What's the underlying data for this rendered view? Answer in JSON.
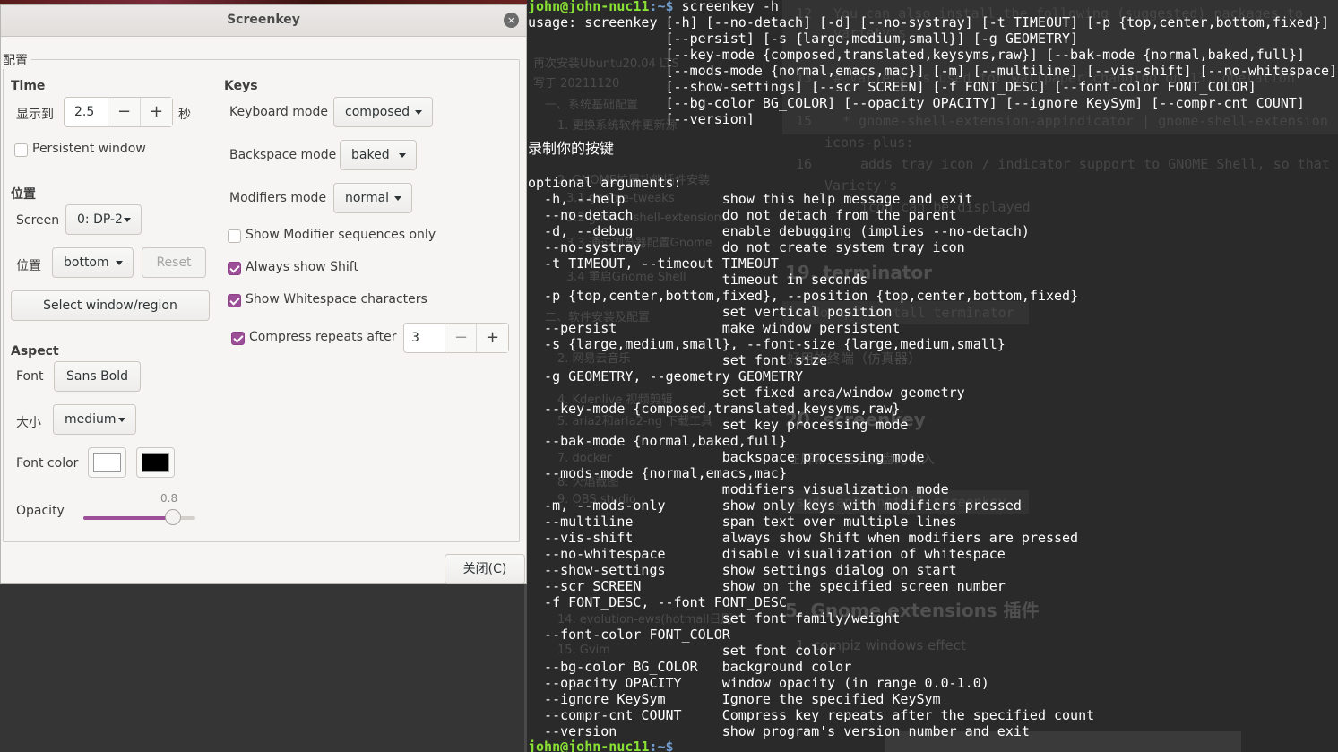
{
  "dialog": {
    "title": "Screenkey",
    "close_glyph": "×",
    "section_config": "配置",
    "time": {
      "header": "Time",
      "show_label": "显示到",
      "show_value": "2.5",
      "unit": "秒",
      "minus": "−",
      "plus": "+",
      "persistent_label": "Persistent window",
      "persistent_checked": false
    },
    "position": {
      "header": "位置",
      "screen_label": "Screen",
      "screen_value": "0: DP-2",
      "pos_label": "位置",
      "pos_value": "bottom",
      "reset_label": "Reset",
      "select_label": "Select window/region"
    },
    "aspect": {
      "header": "Aspect",
      "font_label": "Font",
      "font_value": "Sans Bold",
      "size_label": "大小",
      "size_value": "medium",
      "color_label": "Font color",
      "font_color": "#ffffff",
      "bg_color": "#000000",
      "opacity_label": "Opacity",
      "opacity_value": "0.8",
      "opacity_fraction": 0.8
    },
    "keys": {
      "header": "Keys",
      "keyboard_label": "Keyboard mode",
      "keyboard_value": "composed",
      "backspace_label": "Backspace mode",
      "backspace_value": "baked",
      "modifiers_label": "Modifiers mode",
      "modifiers_value": "normal",
      "mod_seq_label": "Show Modifier sequences only",
      "mod_seq_checked": false,
      "shift_label": "Always show Shift",
      "shift_checked": true,
      "whitespace_label": "Show Whitespace characters",
      "whitespace_checked": true,
      "compress_label": "Compress repeats after",
      "compress_checked": true,
      "compress_value": "3"
    },
    "close_button": "关闭(C)",
    "accent_color": "#9c4f96"
  },
  "terminal": {
    "prompt_user": "john@john-nuc11",
    "prompt_sep": ":~$",
    "command": " screenkey -h",
    "lines": [
      "usage: screenkey [-h] [--no-detach] [-d] [--no-systray] [-t TIMEOUT] [-p {top,center,bottom,fixed}]",
      "                 [--persist] [-s {large,medium,small}] [-g GEOMETRY]",
      "                 [--key-mode {composed,translated,keysyms,raw}] [--bak-mode {normal,baked,full}]",
      "                 [--mods-mode {normal,emacs,mac}] [-m] [--multiline] [--vis-shift] [--no-whitespace]",
      "                 [--show-settings] [--scr SCREEN] [-f FONT_DESC] [--font-color FONT_COLOR]",
      "                 [--bg-color BG_COLOR] [--opacity OPACITY] [--ignore KeySym] [--compr-cnt COUNT]",
      "                 [--version]"
    ],
    "heading_cn": "录制你的按键",
    "optional_header": "optional arguments:",
    "options": [
      "  -h, --help            show this help message and exit",
      "  --no-detach           do not detach from the parent",
      "  -d, --debug           enable debugging (implies --no-detach)",
      "  --no-systray          do not create system tray icon",
      "  -t TIMEOUT, --timeout TIMEOUT",
      "                        timeout in seconds",
      "  -p {top,center,bottom,fixed}, --position {top,center,bottom,fixed}",
      "                        set vertical position",
      "  --persist             make window persistent",
      "  -s {large,medium,small}, --font-size {large,medium,small}",
      "                        set font size",
      "  -g GEOMETRY, --geometry GEOMETRY",
      "                        set fixed area/window geometry",
      "  --key-mode {composed,translated,keysyms,raw}",
      "                        set key processing mode",
      "  --bak-mode {normal,baked,full}",
      "                        backspace processing mode",
      "  --mods-mode {normal,emacs,mac}",
      "                        modifiers visualization mode",
      "  -m, --mods-only       show only keys with modifiers pressed",
      "  --multiline           span text over multiple lines",
      "  --vis-shift           always show Shift when modifiers are pressed",
      "  --no-whitespace       disable visualization of whitespace",
      "  --show-settings       show settings dialog on start",
      "  --scr SCREEN          show on the specified screen number",
      "  -f FONT_DESC, --font FONT_DESC",
      "                        set font family/weight",
      "  --font-color FONT_COLOR",
      "                        set font color",
      "  --bg-color BG_COLOR   background color",
      "  --opacity OPACITY     window opacity (in range 0.0-1.0)",
      "  --ignore KeySym       Ignore the specified KeySym",
      "  --compr-cnt COUNT     Compress key repeats after the specified count",
      "  --version             show program's version number and exit"
    ],
    "final_prompt_user": "john@john-nuc11",
    "final_prompt_sep": ":~$"
  },
  "background_doc": {
    "toc": [
      "再次安装Ubuntu20.04 LTS",
      "写于 20211120",
      "一、系统基础配置",
      "1. 更换系统软件更新源",
      "2. GNOME扩展功能插件安装",
      "3.1 gnome-tweaks",
      "3.2 gnome-shell-extensions",
      "3.3 通过浏览器配置Gnome",
      "3.4 重启Gnome Shell",
      "二、软件安装及配置",
      "2. 网易云音乐",
      "4. Kdenlive 视频剪辑",
      "5. aria2和aria2-ng 下载工具",
      "7. docker",
      "8. 火焰截图",
      "9. OBS studio",
      "14. evolution-ews(hotmail日历",
      "15. Gvim"
    ],
    "code_lines": [
      "You can also install the following (suggested) packages to",
      "variety's",
      "# Variety is used for wallpaper changing on 13, operation",
      "* gnome-shell-extension-appindicator | gnome-shell-extension",
      "icons-plus:",
      "adds tray icon / indicator support to GNOME Shell, so that",
      "Variety's",
      "icon can be displayed",
      "sudo apt install terminator",
      "sudo apt install screenkey"
    ],
    "line_numbers": [
      "12",
      "13",
      "15",
      "16"
    ],
    "headings": [
      "19. terminator",
      "20. screenkey",
      "5. Gnome extensions 插件"
    ],
    "notes": [
      "好用的终端（仿真器）",
      "在屏幕上显示键盘的输入",
      "1. compiz windows effect"
    ]
  }
}
